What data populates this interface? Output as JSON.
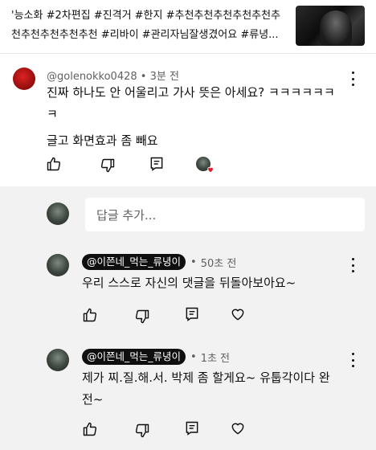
{
  "video": {
    "title_line1": "'능소화 #2차편집 #진격거 #한지 #추천추천추천추천추천추",
    "title_line2": "천추천추천추천추천 #리바이 #관리자님잘생겼어요 #류녕..."
  },
  "comment": {
    "author": "@golenokko0428",
    "time": "3분 전",
    "text_line1": "진짜 하나도 안 어울리고 가사 뜻은 아세요? ㅋㅋㅋㅋㅋㅋ",
    "text_line2": "ㅋ",
    "text_line3": "글고 화면효과 좀 빼요"
  },
  "reply_box": {
    "placeholder": "답글 추가..."
  },
  "replies": [
    {
      "author": "@이쯘네_먹는_류녕이",
      "time": "50초 전",
      "text_line1": "우리 스스로 자신의 댓글을 뒤돌아보아요~",
      "text_line2": ""
    },
    {
      "author": "@이쯘네_먹는_류녕이",
      "time": "1초 전",
      "text_line1": "제가 찌.질.해.서. 박제 좀 할게요~ 유툽각이다 완",
      "text_line2": "전~"
    }
  ],
  "colors": {
    "reply_area_bg": "#f2f2f2",
    "heart": "#e0182a",
    "author_chip": "#0f0f0f"
  },
  "icons": [
    "like-icon",
    "dislike-icon",
    "reply-icon",
    "more-icon",
    "heart-icon"
  ]
}
